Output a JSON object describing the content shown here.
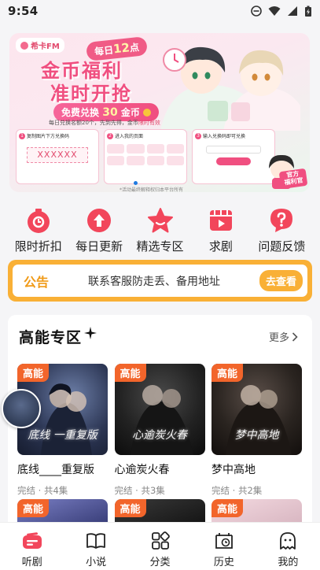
{
  "status_bar": {
    "time": "9:54"
  },
  "banner": {
    "brand": "希卡FM",
    "daily_prefix": "每日",
    "daily_num": "12",
    "daily_suffix": "点",
    "headline_1": "金币福利",
    "headline_2": "准时开抢",
    "pill_prefix": "免费兑换",
    "pill_num": "30",
    "pill_suffix": "金币",
    "sub_text": "每日兑换名额20个，先到先得，金币",
    "sub_highlight": "限时有效",
    "step1_label": "复制图片下方兑换码",
    "step1_code": "XXXXXX",
    "step2_label": "进入我的页面",
    "step3_label": "输入兑换码即可兑换",
    "footer": "*活动最终解释权归本平台所有",
    "stamp_1": "官方",
    "stamp_2": "福利官"
  },
  "quick_menu": [
    {
      "label": "限时折扣",
      "icon": "timer-icon"
    },
    {
      "label": "每日更新",
      "icon": "upload-arrow-icon"
    },
    {
      "label": "精选专区",
      "icon": "star-icon"
    },
    {
      "label": "求剧",
      "icon": "video-icon"
    },
    {
      "label": "问题反馈",
      "icon": "question-icon"
    }
  ],
  "notice": {
    "tag": "公告",
    "text": "联系客服防走丢、备用地址",
    "button": "去查看"
  },
  "section": {
    "title": "高能专区",
    "more": "更多",
    "cards": [
      {
        "badge": "高能",
        "art": "底线 一重复版",
        "name": "底线____重复版",
        "meta": "完结 · 共4集"
      },
      {
        "badge": "高能",
        "art": "心逾炭火春",
        "name": "心逾炭火春",
        "meta": "完结 · 共3集"
      },
      {
        "badge": "高能",
        "art": "梦中高地",
        "name": "梦中高地",
        "meta": "完结 · 共2集"
      }
    ],
    "cards_row2": [
      {
        "badge": "高能"
      },
      {
        "badge": "高能"
      },
      {
        "badge": "高能"
      }
    ]
  },
  "tabbar": [
    {
      "label": "听剧",
      "icon": "radio-icon",
      "active": true
    },
    {
      "label": "小说",
      "icon": "book-icon"
    },
    {
      "label": "分类",
      "icon": "category-icon"
    },
    {
      "label": "历史",
      "icon": "history-icon"
    },
    {
      "label": "我的",
      "icon": "ghost-profile-icon"
    }
  ],
  "colors": {
    "accent": "#f2465b",
    "notice": "#f9b036",
    "badge": "#f2652b"
  }
}
